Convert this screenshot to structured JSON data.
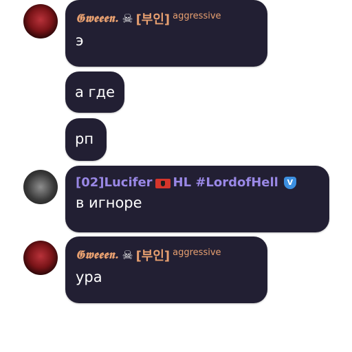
{
  "messages": [
    {
      "author": {
        "nick": "𝕲𝖜𝖊𝖊𝖊𝖓.",
        "icon": "skull-crossbones-icon",
        "tag": "[부인]",
        "role": "aggressive"
      },
      "text": "э"
    },
    {
      "text": "а где"
    },
    {
      "text": "рп"
    },
    {
      "author": {
        "name": "[02]Lucifer",
        "flag_icon": "albania-flag-icon",
        "suffix": "HL #LordofHell",
        "badge_icon": "shield-badge-icon",
        "badge_letter": "V"
      },
      "text": "в игноре"
    },
    {
      "author": {
        "nick": "𝕲𝖜𝖊𝖊𝖊𝖓.",
        "icon": "skull-crossbones-icon",
        "tag": "[부인]",
        "role": "aggressive"
      },
      "text": "ура"
    }
  ],
  "colors": {
    "bubble": "#221f33",
    "nick": "#e8a070",
    "name_purple": "#9a88e6",
    "badge": "#3c8fe0"
  }
}
